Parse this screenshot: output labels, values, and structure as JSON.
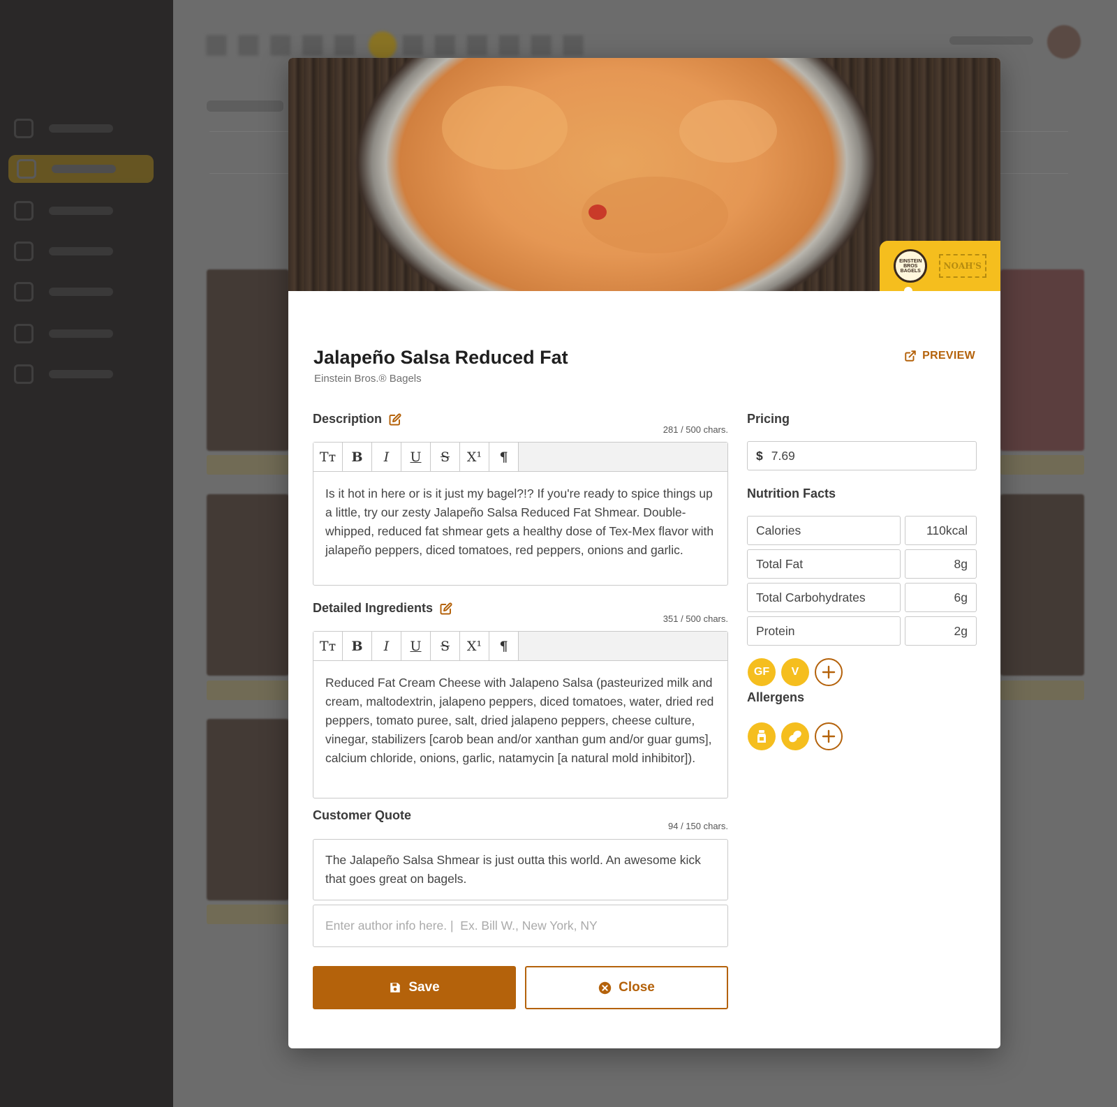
{
  "modal": {
    "title": "Jalapeño Salsa Reduced Fat",
    "brand": "Einstein Bros.® Bagels",
    "preview_label": "PREVIEW",
    "brands": {
      "einstein_badge": "EINSTEIN BROS BAGELS",
      "noahs_badge": "NOAH'S"
    },
    "description": {
      "label": "Description",
      "count": "281 / 500 chars.",
      "text": "Is it hot in here or is it just my bagel?!? If you're ready to spice things up a little, try our zesty Jalapeño Salsa Reduced Fat Shmear. Double-whipped, reduced fat shmear gets a healthy dose of Tex-Mex flavor with jalapeño peppers, diced tomatoes, red peppers, onions and garlic."
    },
    "ingredients": {
      "label": "Detailed Ingredients",
      "count": "351 / 500 chars.",
      "text": "Reduced Fat Cream Cheese with Jalapeno Salsa (pasteurized milk and cream, maltodextrin, jalapeno peppers, diced tomatoes, water, dried red peppers, tomato puree, salt, dried jalapeno peppers, cheese culture, vinegar, stabilizers [carob bean and/or xanthan gum and/or guar gums], calcium chloride, onions, garlic, natamycin [a natural mold inhibitor])."
    },
    "quote": {
      "label": "Customer Quote",
      "count": "94 / 150 chars.",
      "text": "The Jalapeño Salsa Shmear is just outta this world. An awesome kick that goes great on bagels.",
      "author_placeholder": "Enter author info here. |  Ex. Bill W., New York, NY"
    },
    "toolbar": {
      "text_size": "Tт",
      "bold": "B",
      "italic": "I",
      "underline": "U",
      "strike": "S",
      "superscript": "X¹",
      "paragraph": "¶"
    },
    "pricing": {
      "label": "Pricing",
      "currency": "$",
      "value": "7.69"
    },
    "nutrition": {
      "label": "Nutrition Facts",
      "rows": [
        {
          "name": "Calories",
          "value": "110kcal"
        },
        {
          "name": "Total Fat",
          "value": "8g"
        },
        {
          "name": "Total Carbohydrates",
          "value": "6g"
        },
        {
          "name": "Protein",
          "value": "2g"
        }
      ],
      "tags": [
        "GF",
        "V"
      ]
    },
    "allergens": {
      "label": "Allergens",
      "icons": [
        "milk-icon",
        "peanut-icon"
      ]
    },
    "actions": {
      "save": "Save",
      "close": "Close"
    },
    "colors": {
      "accent": "#b4620b",
      "yellow": "#f5be1e"
    }
  }
}
